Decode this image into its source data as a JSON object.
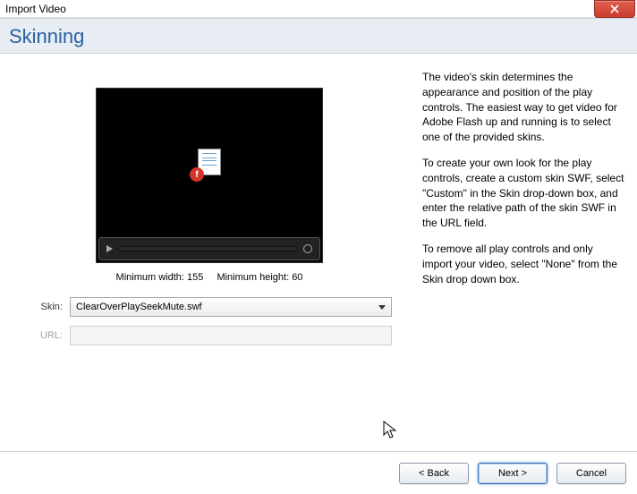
{
  "window": {
    "title": "Import Video"
  },
  "heading": "Skinning",
  "info": {
    "p1": "The video's skin determines the appearance and position of the play controls.  The easiest way to get video for Adobe Flash up and running is to select one of the provided skins.",
    "p2": "To create your own look for the play controls, create a custom skin SWF, select \"Custom\" in the Skin drop-down box, and enter the relative path of the skin SWF in the URL field.",
    "p3": "To remove all play controls and only import your video, select \"None\" from the Skin drop down box."
  },
  "dims": {
    "min_width_label": "Minimum width: 155",
    "min_height_label": "Minimum height: 60"
  },
  "form": {
    "skin_label": "Skin:",
    "skin_value": "ClearOverPlaySeekMute.swf",
    "url_label": "URL:",
    "url_value": ""
  },
  "buttons": {
    "back": "< Back",
    "next": "Next >",
    "cancel": "Cancel"
  }
}
